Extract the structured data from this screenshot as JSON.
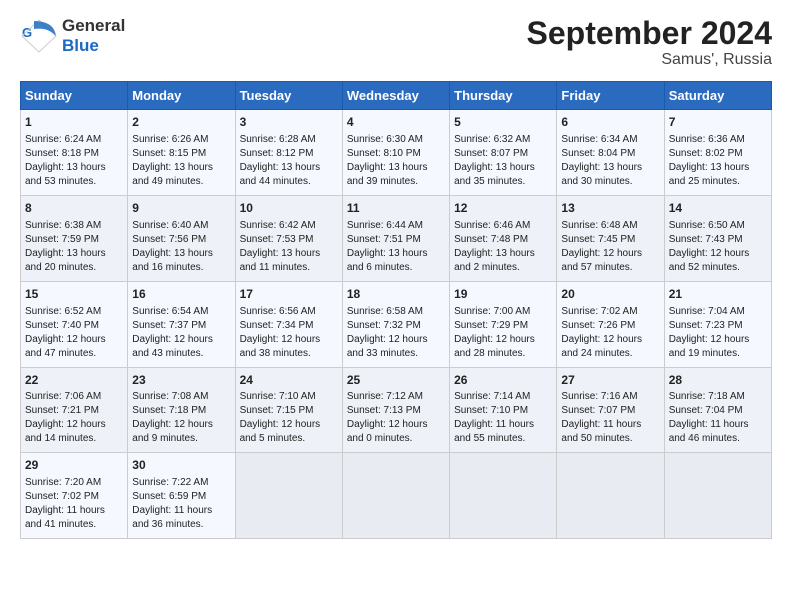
{
  "header": {
    "logo_text_general": "General",
    "logo_text_blue": "Blue",
    "title": "September 2024",
    "subtitle": "Samus', Russia"
  },
  "days_of_week": [
    "Sunday",
    "Monday",
    "Tuesday",
    "Wednesday",
    "Thursday",
    "Friday",
    "Saturday"
  ],
  "weeks": [
    [
      {
        "day": "1",
        "lines": [
          "Sunrise: 6:24 AM",
          "Sunset: 8:18 PM",
          "Daylight: 13 hours",
          "and 53 minutes."
        ]
      },
      {
        "day": "2",
        "lines": [
          "Sunrise: 6:26 AM",
          "Sunset: 8:15 PM",
          "Daylight: 13 hours",
          "and 49 minutes."
        ]
      },
      {
        "day": "3",
        "lines": [
          "Sunrise: 6:28 AM",
          "Sunset: 8:12 PM",
          "Daylight: 13 hours",
          "and 44 minutes."
        ]
      },
      {
        "day": "4",
        "lines": [
          "Sunrise: 6:30 AM",
          "Sunset: 8:10 PM",
          "Daylight: 13 hours",
          "and 39 minutes."
        ]
      },
      {
        "day": "5",
        "lines": [
          "Sunrise: 6:32 AM",
          "Sunset: 8:07 PM",
          "Daylight: 13 hours",
          "and 35 minutes."
        ]
      },
      {
        "day": "6",
        "lines": [
          "Sunrise: 6:34 AM",
          "Sunset: 8:04 PM",
          "Daylight: 13 hours",
          "and 30 minutes."
        ]
      },
      {
        "day": "7",
        "lines": [
          "Sunrise: 6:36 AM",
          "Sunset: 8:02 PM",
          "Daylight: 13 hours",
          "and 25 minutes."
        ]
      }
    ],
    [
      {
        "day": "8",
        "lines": [
          "Sunrise: 6:38 AM",
          "Sunset: 7:59 PM",
          "Daylight: 13 hours",
          "and 20 minutes."
        ]
      },
      {
        "day": "9",
        "lines": [
          "Sunrise: 6:40 AM",
          "Sunset: 7:56 PM",
          "Daylight: 13 hours",
          "and 16 minutes."
        ]
      },
      {
        "day": "10",
        "lines": [
          "Sunrise: 6:42 AM",
          "Sunset: 7:53 PM",
          "Daylight: 13 hours",
          "and 11 minutes."
        ]
      },
      {
        "day": "11",
        "lines": [
          "Sunrise: 6:44 AM",
          "Sunset: 7:51 PM",
          "Daylight: 13 hours",
          "and 6 minutes."
        ]
      },
      {
        "day": "12",
        "lines": [
          "Sunrise: 6:46 AM",
          "Sunset: 7:48 PM",
          "Daylight: 13 hours",
          "and 2 minutes."
        ]
      },
      {
        "day": "13",
        "lines": [
          "Sunrise: 6:48 AM",
          "Sunset: 7:45 PM",
          "Daylight: 12 hours",
          "and 57 minutes."
        ]
      },
      {
        "day": "14",
        "lines": [
          "Sunrise: 6:50 AM",
          "Sunset: 7:43 PM",
          "Daylight: 12 hours",
          "and 52 minutes."
        ]
      }
    ],
    [
      {
        "day": "15",
        "lines": [
          "Sunrise: 6:52 AM",
          "Sunset: 7:40 PM",
          "Daylight: 12 hours",
          "and 47 minutes."
        ]
      },
      {
        "day": "16",
        "lines": [
          "Sunrise: 6:54 AM",
          "Sunset: 7:37 PM",
          "Daylight: 12 hours",
          "and 43 minutes."
        ]
      },
      {
        "day": "17",
        "lines": [
          "Sunrise: 6:56 AM",
          "Sunset: 7:34 PM",
          "Daylight: 12 hours",
          "and 38 minutes."
        ]
      },
      {
        "day": "18",
        "lines": [
          "Sunrise: 6:58 AM",
          "Sunset: 7:32 PM",
          "Daylight: 12 hours",
          "and 33 minutes."
        ]
      },
      {
        "day": "19",
        "lines": [
          "Sunrise: 7:00 AM",
          "Sunset: 7:29 PM",
          "Daylight: 12 hours",
          "and 28 minutes."
        ]
      },
      {
        "day": "20",
        "lines": [
          "Sunrise: 7:02 AM",
          "Sunset: 7:26 PM",
          "Daylight: 12 hours",
          "and 24 minutes."
        ]
      },
      {
        "day": "21",
        "lines": [
          "Sunrise: 7:04 AM",
          "Sunset: 7:23 PM",
          "Daylight: 12 hours",
          "and 19 minutes."
        ]
      }
    ],
    [
      {
        "day": "22",
        "lines": [
          "Sunrise: 7:06 AM",
          "Sunset: 7:21 PM",
          "Daylight: 12 hours",
          "and 14 minutes."
        ]
      },
      {
        "day": "23",
        "lines": [
          "Sunrise: 7:08 AM",
          "Sunset: 7:18 PM",
          "Daylight: 12 hours",
          "and 9 minutes."
        ]
      },
      {
        "day": "24",
        "lines": [
          "Sunrise: 7:10 AM",
          "Sunset: 7:15 PM",
          "Daylight: 12 hours",
          "and 5 minutes."
        ]
      },
      {
        "day": "25",
        "lines": [
          "Sunrise: 7:12 AM",
          "Sunset: 7:13 PM",
          "Daylight: 12 hours",
          "and 0 minutes."
        ]
      },
      {
        "day": "26",
        "lines": [
          "Sunrise: 7:14 AM",
          "Sunset: 7:10 PM",
          "Daylight: 11 hours",
          "and 55 minutes."
        ]
      },
      {
        "day": "27",
        "lines": [
          "Sunrise: 7:16 AM",
          "Sunset: 7:07 PM",
          "Daylight: 11 hours",
          "and 50 minutes."
        ]
      },
      {
        "day": "28",
        "lines": [
          "Sunrise: 7:18 AM",
          "Sunset: 7:04 PM",
          "Daylight: 11 hours",
          "and 46 minutes."
        ]
      }
    ],
    [
      {
        "day": "29",
        "lines": [
          "Sunrise: 7:20 AM",
          "Sunset: 7:02 PM",
          "Daylight: 11 hours",
          "and 41 minutes."
        ]
      },
      {
        "day": "30",
        "lines": [
          "Sunrise: 7:22 AM",
          "Sunset: 6:59 PM",
          "Daylight: 11 hours",
          "and 36 minutes."
        ]
      },
      {
        "day": "",
        "lines": []
      },
      {
        "day": "",
        "lines": []
      },
      {
        "day": "",
        "lines": []
      },
      {
        "day": "",
        "lines": []
      },
      {
        "day": "",
        "lines": []
      }
    ]
  ]
}
